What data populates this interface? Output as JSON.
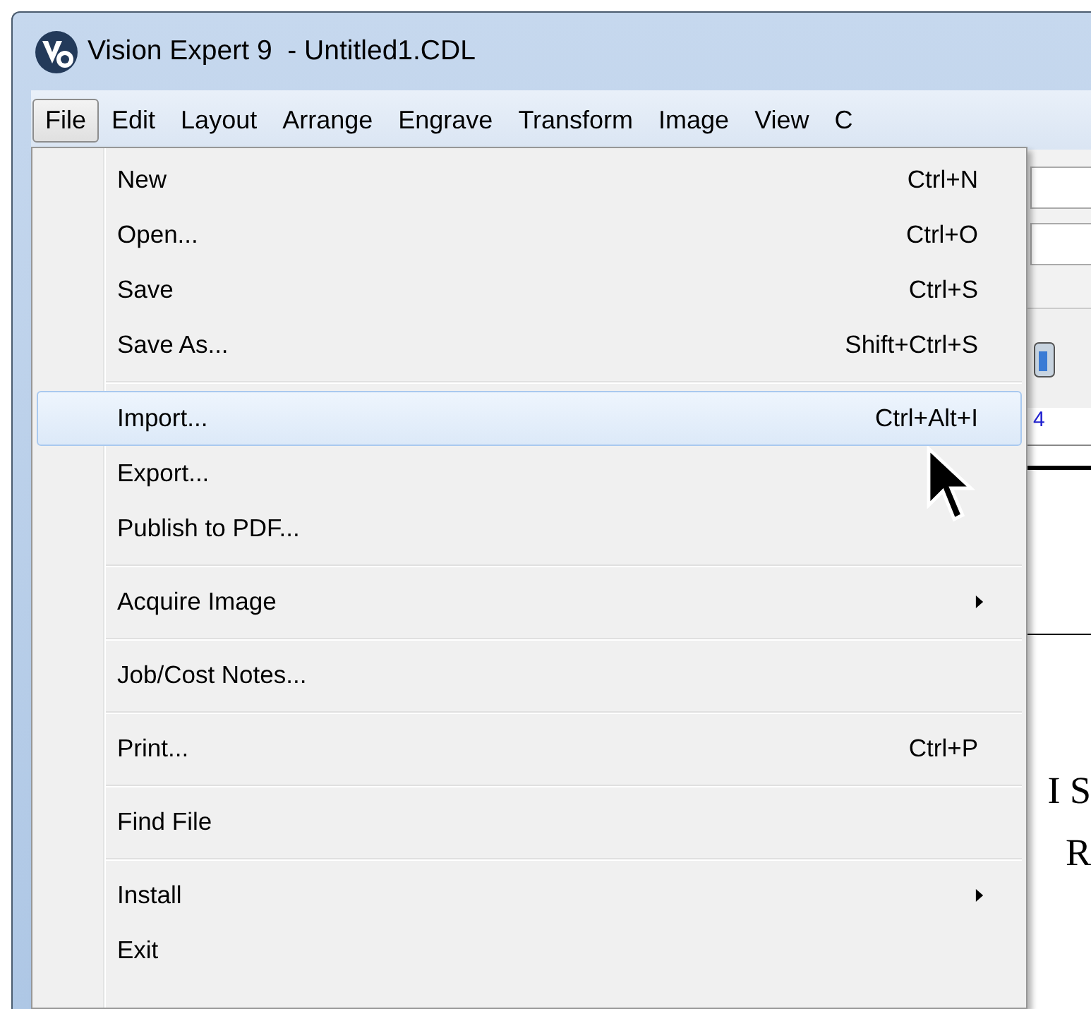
{
  "window": {
    "title": "Vision Expert 9  - Untitled1.CDL"
  },
  "menu_bar": [
    {
      "label": "File",
      "selected": true
    },
    {
      "label": "Edit",
      "selected": false
    },
    {
      "label": "Layout",
      "selected": false
    },
    {
      "label": "Arrange",
      "selected": false
    },
    {
      "label": "Engrave",
      "selected": false
    },
    {
      "label": "Transform",
      "selected": false
    },
    {
      "label": "Image",
      "selected": false
    },
    {
      "label": "View",
      "selected": false
    },
    {
      "label": "C",
      "selected": false
    }
  ],
  "file_menu": {
    "groups": [
      [
        {
          "label": "New",
          "shortcut": "Ctrl+N",
          "selected": false
        },
        {
          "label": "Open...",
          "shortcut": "Ctrl+O",
          "selected": false
        },
        {
          "label": "Save",
          "shortcut": "Ctrl+S",
          "selected": false
        },
        {
          "label": "Save As...",
          "shortcut": "Shift+Ctrl+S",
          "selected": false
        }
      ],
      [
        {
          "label": "Import...",
          "shortcut": "Ctrl+Alt+I",
          "selected": true
        },
        {
          "label": "Export...",
          "selected": false
        },
        {
          "label": "Publish to PDF...",
          "selected": false
        }
      ],
      [
        {
          "label": "Acquire Image",
          "submenu": true,
          "selected": false
        }
      ],
      [
        {
          "label": "Job/Cost Notes...",
          "selected": false
        }
      ],
      [
        {
          "label": "Print...",
          "shortcut": "Ctrl+P",
          "selected": false
        }
      ],
      [
        {
          "label": "Find File",
          "selected": false
        }
      ],
      [
        {
          "label": "Install",
          "submenu": true,
          "selected": false
        },
        {
          "label": "Exit",
          "selected": false
        }
      ]
    ]
  },
  "canvas": {
    "ruler_number": "4",
    "text_lines": [
      "I S",
      "R"
    ]
  }
}
